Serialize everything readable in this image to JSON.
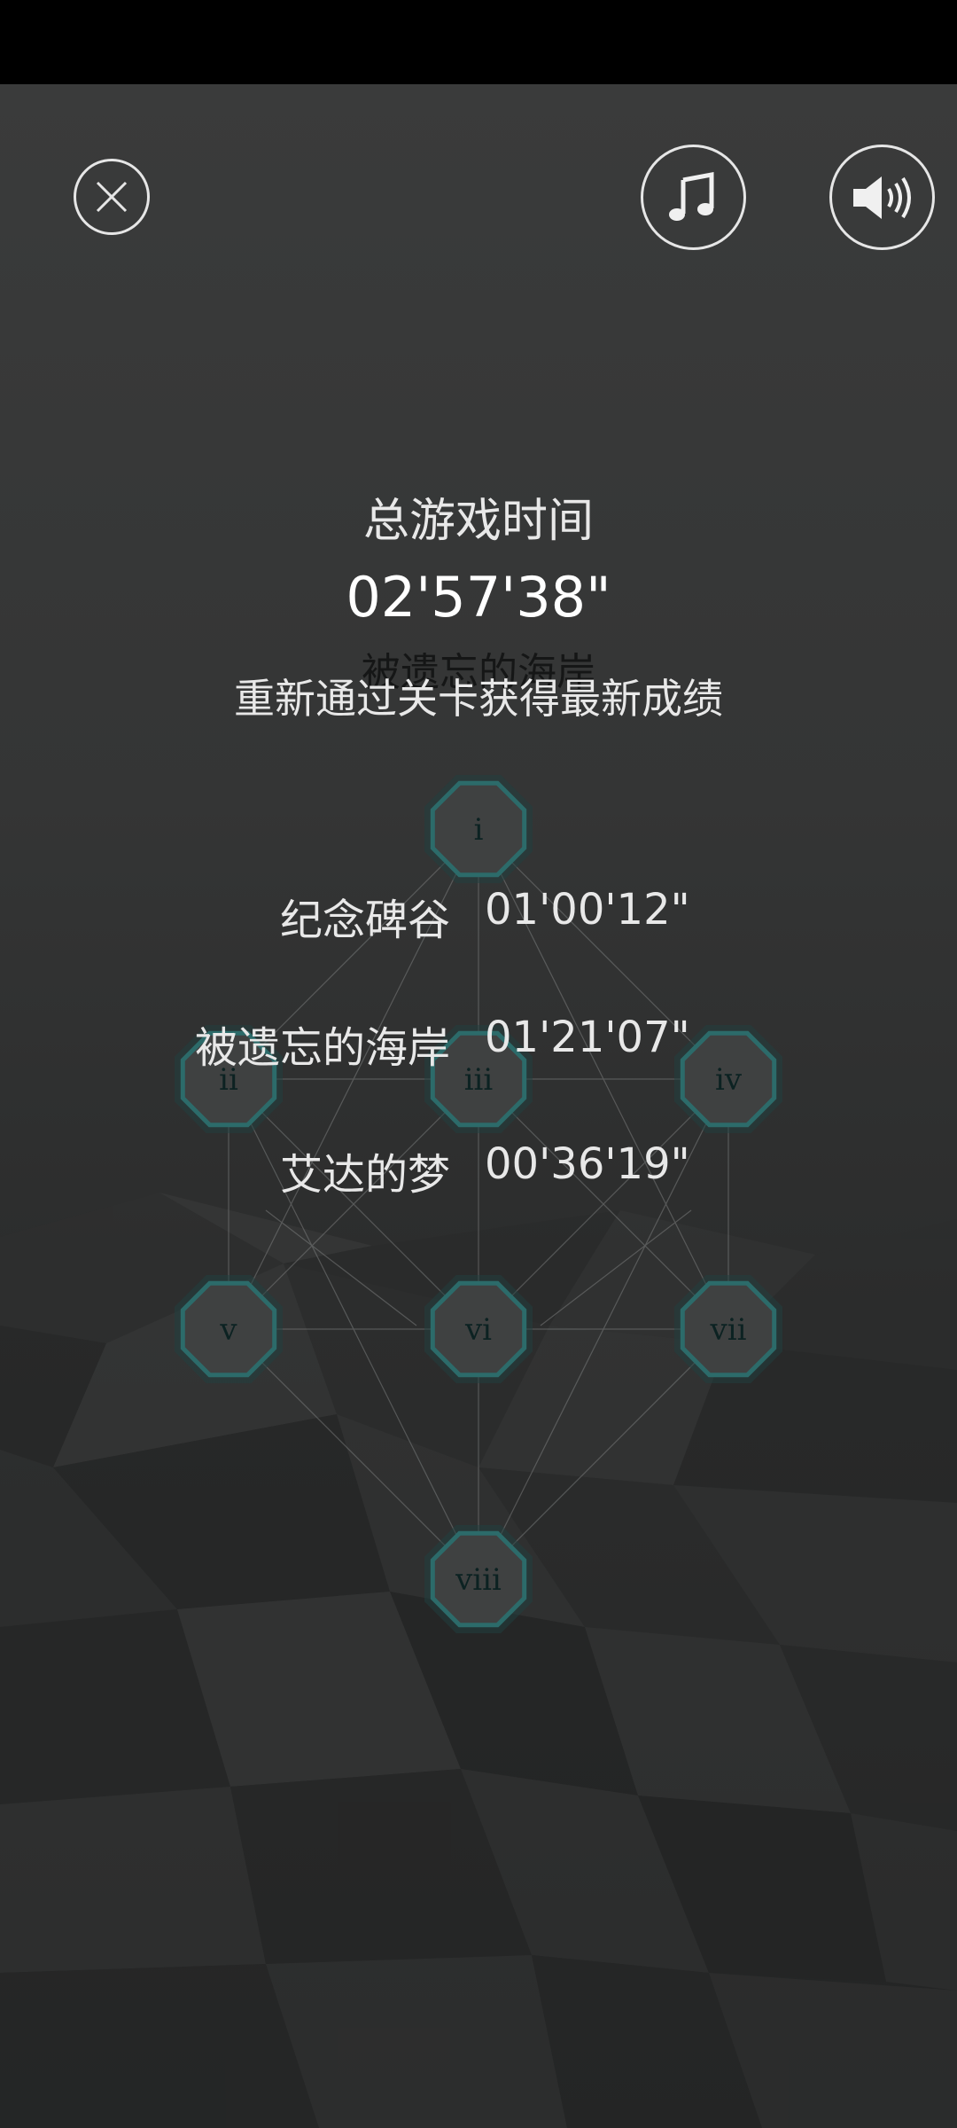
{
  "header": {
    "close_icon": "close-circle-icon",
    "music_icon": "music-note-icon",
    "sound_icon": "speaker-volume-icon"
  },
  "summary": {
    "total_label": "总游戏时间",
    "total_time": "02'57'38\"",
    "ghost_title": "被遗忘的海岸",
    "replay_hint": "重新通过关卡获得最新成绩"
  },
  "records": [
    {
      "name": "纪念碑谷",
      "time": "01'00'12\""
    },
    {
      "name": "被遗忘的海岸",
      "time": "01'21'07\""
    },
    {
      "name": "艾达的梦",
      "time": "00'36'19\""
    }
  ],
  "chapters": [
    {
      "label": "i"
    },
    {
      "label": "ii"
    },
    {
      "label": "iii"
    },
    {
      "label": "iv"
    },
    {
      "label": "v"
    },
    {
      "label": "vi"
    },
    {
      "label": "vii"
    },
    {
      "label": "viii"
    }
  ],
  "colors": {
    "node_fill": "#3f4141",
    "node_border": "#2c6b6a",
    "node_glow": "#1f3f3f",
    "text": "#e8e8e8",
    "lines": "#8a8c8c"
  }
}
